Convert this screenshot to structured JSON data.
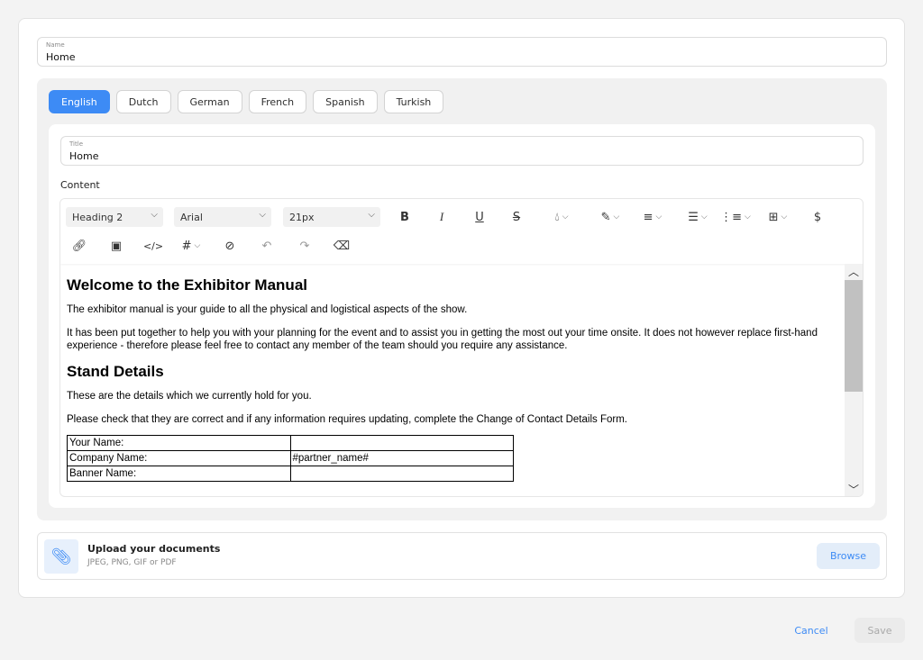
{
  "name_field": {
    "label": "Name",
    "value": "Home"
  },
  "tabs": [
    {
      "label": "English",
      "active": true
    },
    {
      "label": "Dutch"
    },
    {
      "label": "German"
    },
    {
      "label": "French"
    },
    {
      "label": "Spanish"
    },
    {
      "label": "Turkish"
    }
  ],
  "title_field": {
    "label": "Title",
    "value": "Home"
  },
  "content_label": "Content",
  "toolbar": {
    "block_format": "Heading 2",
    "font_family": "Arial",
    "font_size": "21px",
    "currency_symbol": "$"
  },
  "document": {
    "heading1": "Welcome to the Exhibitor Manual",
    "para1": "The exhibitor manual is your guide to all the physical and logistical aspects of the show.",
    "para2": "It has been put together to help you with your planning for the event and to assist you in getting the most out your time onsite. It does not however replace first-hand experience - therefore please feel free to contact any member of the team should you require any assistance.",
    "heading2": "Stand Details",
    "para3": "These are the details which we currently hold for you.",
    "para4": "Please check that they are correct and if any information requires updating, complete the Change of Contact Details Form.",
    "table": [
      [
        "Your Name:",
        ""
      ],
      [
        "Company Name:",
        "#partner_name#"
      ],
      [
        "Banner Name:",
        ""
      ]
    ]
  },
  "upload": {
    "title": "Upload your documents",
    "subtitle": "JPEG, PNG, GIF or PDF",
    "browse_label": "Browse"
  },
  "actions": {
    "cancel_label": "Cancel",
    "save_label": "Save"
  },
  "colors": {
    "accent": "#3d8bf5",
    "panel": "#f1f1f1"
  }
}
